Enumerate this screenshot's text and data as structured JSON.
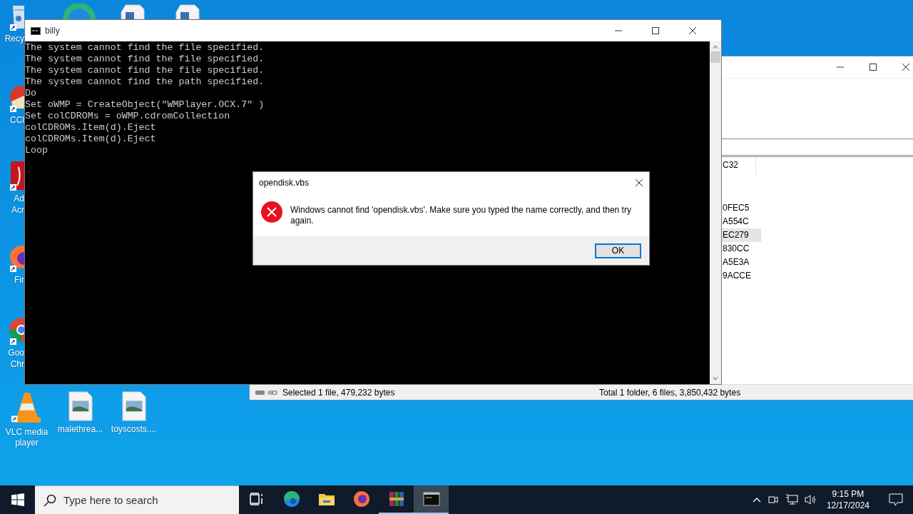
{
  "desktop": {
    "left_icons": [
      {
        "kind": "recycle",
        "label_lines": [
          "Recy"
        ]
      },
      {
        "kind": "ccleaner",
        "label_lines": [
          "CCl"
        ]
      },
      {
        "kind": "acrobat",
        "label_lines": [
          "Ad",
          "Acr"
        ]
      },
      {
        "kind": "firefox",
        "label_lines": [
          "Fir"
        ]
      },
      {
        "kind": "chrome",
        "label_lines": [
          "Goo",
          "Chr"
        ]
      }
    ],
    "top_icons": [
      {
        "kind": "edge"
      },
      {
        "kind": "document"
      },
      {
        "kind": "document"
      }
    ],
    "bottom_icons": [
      {
        "kind": "vlc",
        "label": "VLC media player"
      },
      {
        "kind": "image_file",
        "label": "malethrea..."
      },
      {
        "kind": "image_file",
        "label": "toyscosts...."
      }
    ]
  },
  "explorer": {
    "header_cell": "C32",
    "rows": [
      {
        "text": "0FEC5",
        "selected": false
      },
      {
        "text": "A554C",
        "selected": false
      },
      {
        "text": "EC279",
        "selected": true
      },
      {
        "text": "830CC",
        "selected": false
      },
      {
        "text": "A5E3A",
        "selected": false
      },
      {
        "text": "9ACCE",
        "selected": false
      }
    ],
    "status_left": "Selected 1 file, 479,232 bytes",
    "status_right": "Total 1 folder, 6 files, 3,850,432 bytes"
  },
  "console": {
    "title": "billy",
    "lines": [
      "The system cannot find the file specified.",
      "The system cannot find the file specified.",
      "The system cannot find the file specified.",
      "The system cannot find the path specified.",
      "Do",
      "Set oWMP = CreateObject(\"WMPlayer.OCX.7\" )",
      "Set colCDROMs = oWMP.cdromCollection",
      "colCDROMs.Item(d).Eject",
      "colCDROMs.Item(d).Eject",
      "Loop"
    ]
  },
  "dialog": {
    "title": "opendisk.vbs",
    "message": "Windows cannot find 'opendisk.vbs'. Make sure you typed the name correctly, and then try again.",
    "button": "OK"
  },
  "taskbar": {
    "search_placeholder": "Type here to search",
    "apps": [
      {
        "kind": "task_view",
        "running": false,
        "active": false
      },
      {
        "kind": "edge",
        "running": false,
        "active": false
      },
      {
        "kind": "explorer",
        "running": false,
        "active": false
      },
      {
        "kind": "firefox",
        "running": false,
        "active": false
      },
      {
        "kind": "winrar",
        "running": true,
        "active": false
      },
      {
        "kind": "cmd",
        "running": true,
        "active": true
      }
    ],
    "time": "9:15 PM",
    "date": "12/17/2024"
  }
}
